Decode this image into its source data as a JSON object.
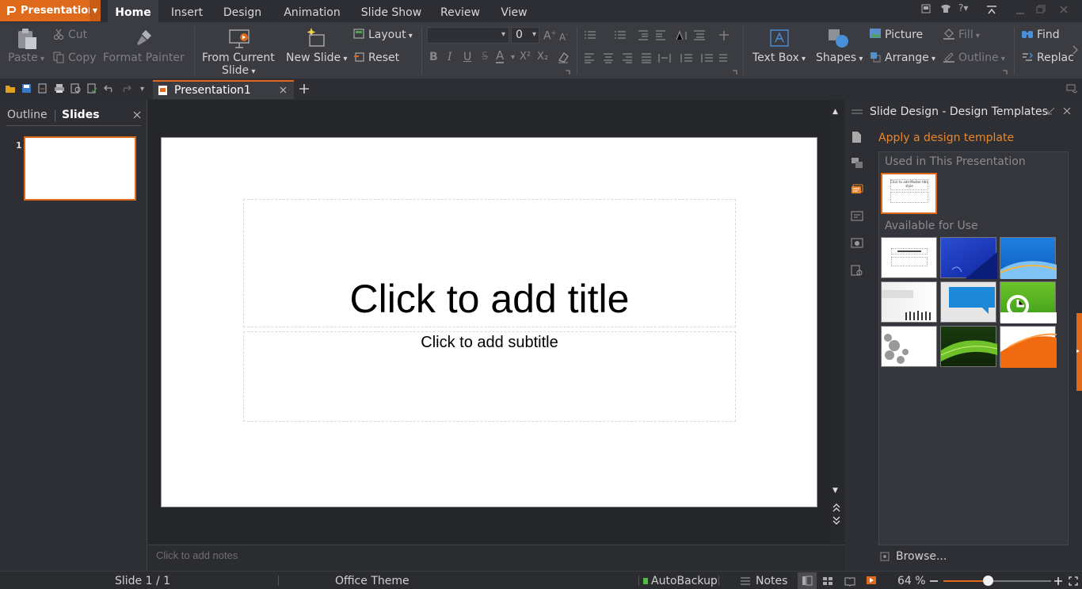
{
  "app": {
    "name": "Presentation"
  },
  "menu": {
    "tabs": [
      "Home",
      "Insert",
      "Design",
      "Animation",
      "Slide Show",
      "Review",
      "View"
    ]
  },
  "ribbon": {
    "paste": "Paste",
    "cut": "Cut",
    "copy": "Copy",
    "format_painter": "Format Painter",
    "from_current_1": "From Current",
    "from_current_2": "Slide",
    "new_slide": "New Slide",
    "layout": "Layout",
    "reset": "Reset",
    "font_size": "0",
    "bold": "B",
    "italic": "I",
    "underline": "U",
    "strike": "S",
    "font_color": "A",
    "superscript": "X²",
    "subscript": "X₂",
    "text_box": "Text Box",
    "shapes": "Shapes",
    "picture": "Picture",
    "arrange": "Arrange",
    "fill": "Fill",
    "outline": "Outline",
    "find": "Find",
    "replace": "Replac"
  },
  "document": {
    "tab": "Presentation1"
  },
  "left_pane": {
    "tab_outline": "Outline",
    "tab_slides": "Slides",
    "slide_number": "1"
  },
  "slide": {
    "title": "Click to add title",
    "subtitle": "Click to add subtitle"
  },
  "notes": {
    "placeholder": "Click to add notes"
  },
  "right_pane": {
    "title": "Slide Design - Design Templates",
    "apply": "Apply a design template",
    "used": "Used in This Presentation",
    "available": "Available for Use",
    "browse": "Browse...",
    "used_thumb_title": "Click to add Master title style"
  },
  "status": {
    "slide": "Slide 1 / 1",
    "theme": "Office Theme",
    "autobackup": "AutoBackup",
    "notes": "Notes",
    "zoom": "64 %",
    "zoom_fraction": 0.41
  },
  "colors": {
    "accent": "#e06a1b",
    "ribbon": "#3b3c42",
    "background": "#2b2c30"
  }
}
